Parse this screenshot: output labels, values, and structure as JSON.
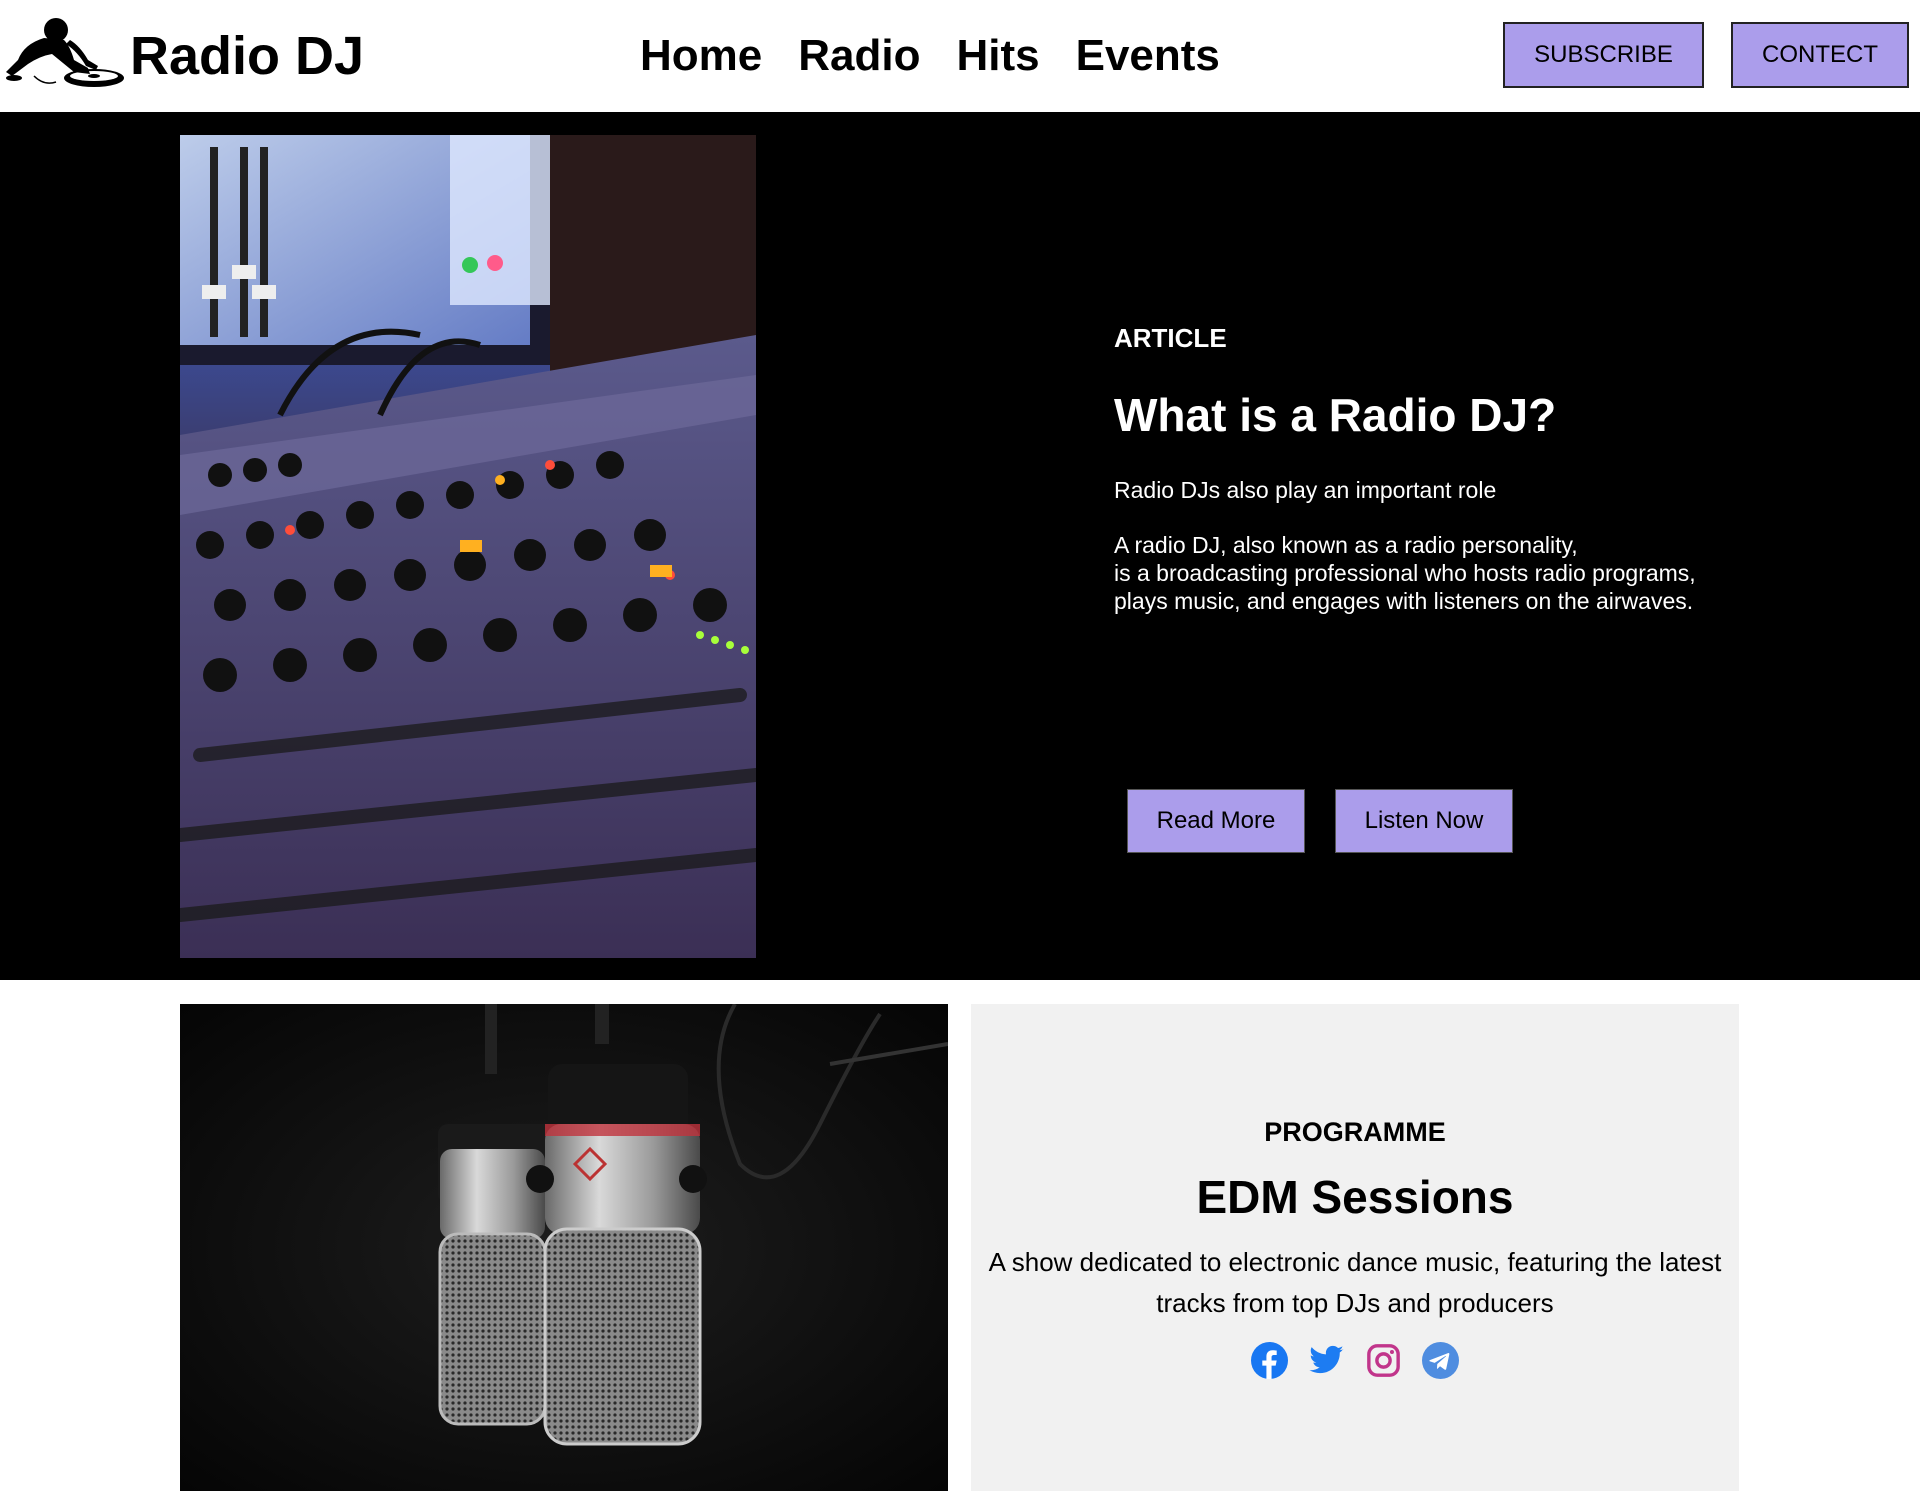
{
  "header": {
    "brand": "Radio DJ",
    "nav": [
      "Home",
      "Radio",
      "Hits",
      "Events"
    ],
    "subscribe_label": "SUBSCRIBE",
    "contact_label": "CONTECT"
  },
  "hero": {
    "eyebrow": "ARTICLE",
    "title": "What is a Radio DJ?",
    "subtitle": "Radio DJs also play an important role",
    "description": "A radio DJ, also known as a radio personality,\nis a broadcasting professional who hosts radio programs,\nplays music, and engages with listeners on the airwaves.",
    "read_more_label": "Read More",
    "listen_now_label": "Listen Now",
    "image": "audio-mixing-console-photo"
  },
  "programme": {
    "eyebrow": "PROGRAMME",
    "title": "EDM Sessions",
    "description": "A show dedicated to electronic dance music, featuring the latest tracks from top DJs and producers",
    "image": "studio-microphones-photo",
    "socials": [
      {
        "icon": "facebook-icon",
        "color": "#1877f2"
      },
      {
        "icon": "twitter-icon",
        "color": "#1d7cf2"
      },
      {
        "icon": "instagram-icon",
        "color": "#c1358b"
      },
      {
        "icon": "telegram-icon",
        "color": "#4f8de0"
      }
    ]
  },
  "colors": {
    "accent": "#ab9deb",
    "hero_bg": "#000000",
    "card_bg": "#f1f1f1"
  }
}
